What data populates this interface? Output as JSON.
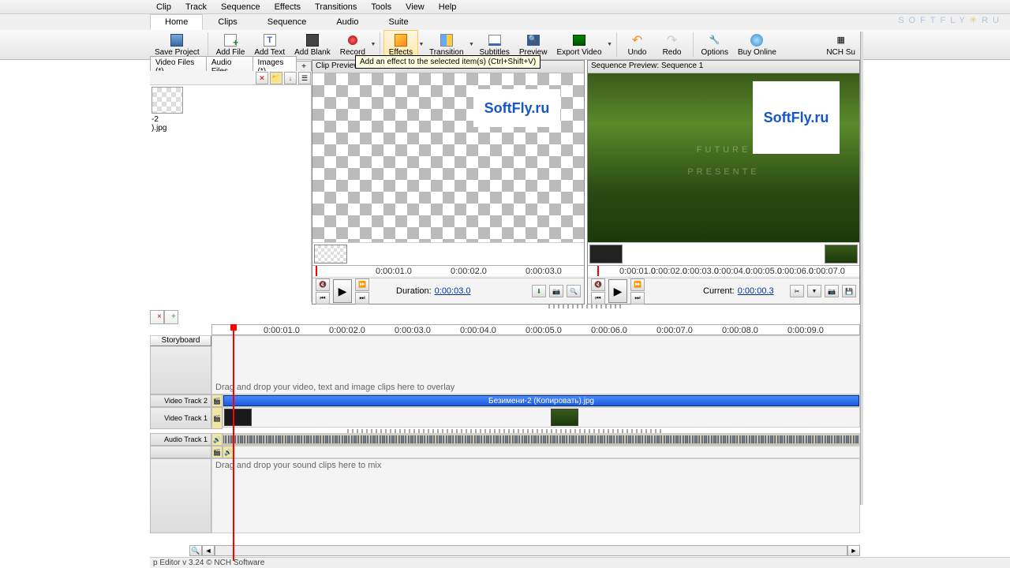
{
  "menu": {
    "items": [
      "Clip",
      "Track",
      "Sequence",
      "Effects",
      "Transitions",
      "Tools",
      "View",
      "Help"
    ]
  },
  "tabs": {
    "items": [
      "Home",
      "Clips",
      "Sequence",
      "Audio",
      "Suite"
    ],
    "active": 0
  },
  "ribbon": {
    "save": "Save Project",
    "addfile": "Add File",
    "addtext": "Add Text",
    "addblank": "Add Blank",
    "record": "Record",
    "effects": "Effects",
    "transition": "Transition",
    "subtitles": "Subtitles",
    "preview": "Preview",
    "export": "Export Video",
    "undo": "Undo",
    "redo": "Redo",
    "options": "Options",
    "buy": "Buy Online",
    "nch": "NCH Su"
  },
  "watermark": {
    "text": "SOFTFLY",
    "suffix": "RU"
  },
  "tooltip": "Add an effect to the selected item(s) (Ctrl+Shift+V)",
  "mediatabs": {
    "video": "Video Files (*)",
    "audio": "Audio Files",
    "images": "Images (*)"
  },
  "thumb": {
    "name1": "-2",
    "name2": ").jpg"
  },
  "clippreview": {
    "title": "Clip Preview: Безим",
    "logo": "SoftFly.ru",
    "ticks": [
      "0:00:01.0",
      "0:00:02.0",
      "0:00:03.0"
    ],
    "duration_lbl": "Duration:",
    "duration": "0:00:03.0"
  },
  "seqpreview": {
    "title": "Sequence Preview: Sequence 1",
    "logo": "SoftFly.ru",
    "overlay1": "FUTURE",
    "overlay2": "PRESENTE",
    "ticks": [
      "0:00:01.0",
      "0:00:02.0",
      "0:00:03.0",
      "0:00:04.0",
      "0:00:05.0",
      "0:00:06.0",
      "0:00:07.0"
    ],
    "current_lbl": "Current:",
    "current": "0:00:00.3"
  },
  "timeline": {
    "tab_close": "×",
    "tab_plus": "+",
    "storyboard": "Storyboard",
    "ticks": [
      "0:00:01.0",
      "0:00:02.0",
      "0:00:03.0",
      "0:00:04.0",
      "0:00:05.0",
      "0:00:06.0",
      "0:00:07.0",
      "0:00:08.0",
      "0:00:09.0"
    ],
    "overlay_hint": "Drag and drop your video, text and image clips here to overlay",
    "video2": "Video Track 2",
    "video1": "Video Track 1",
    "audio1": "Audio Track 1",
    "mix_hint": "Drag and drop your sound clips here to mix",
    "blueclip": "Безимени-2 (Копировать).jpg"
  },
  "status": "p Editor v 3.24 © NCH Software"
}
